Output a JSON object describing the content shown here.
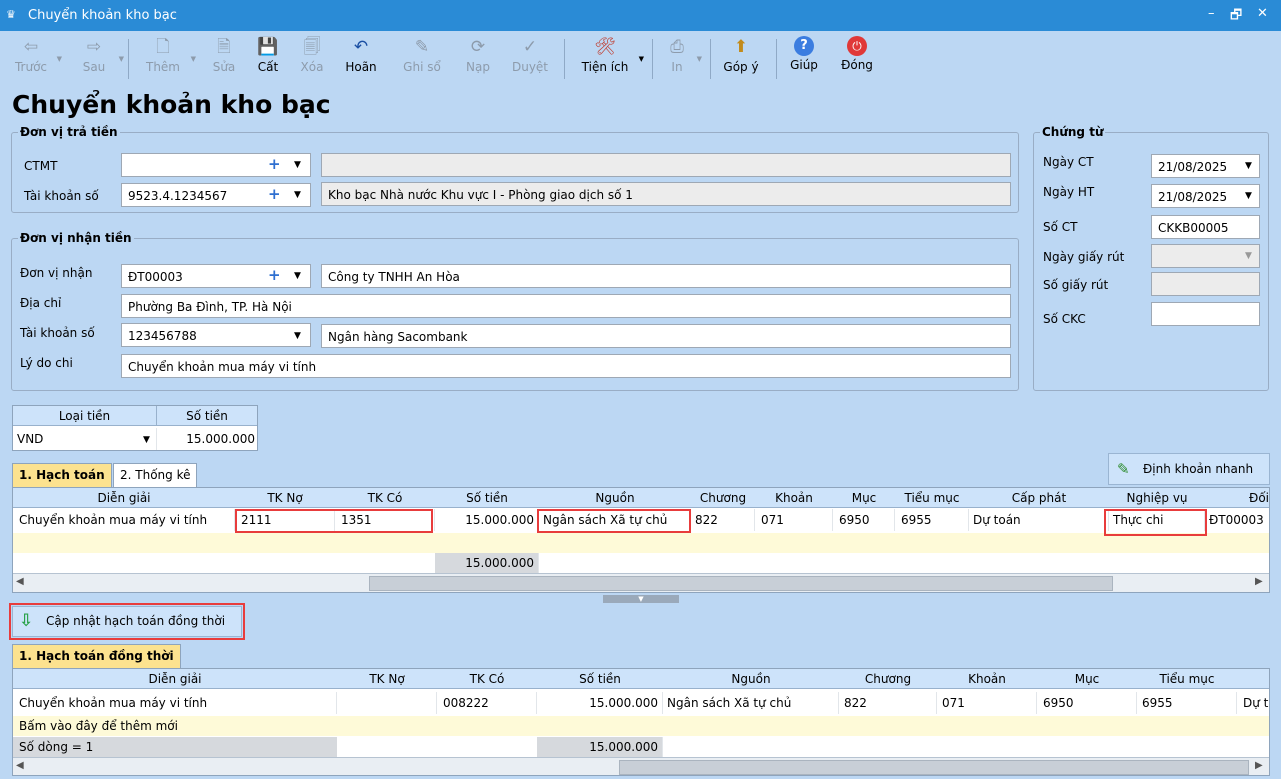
{
  "window": {
    "title": "Chuyển khoản kho bạc",
    "min": "–",
    "restore": "🗗",
    "close": "✕"
  },
  "toolbar": [
    {
      "id": "prev",
      "label": "Trước",
      "icon": "arrow-left-icon",
      "glyph": "⇦",
      "enabled": false
    },
    {
      "id": "next",
      "label": "Sau",
      "icon": "arrow-right-icon",
      "glyph": "⇨",
      "enabled": false
    },
    {
      "id": "add",
      "label": "Thêm",
      "icon": "add-document-icon",
      "glyph": "🗋",
      "enabled": false
    },
    {
      "id": "edit",
      "label": "Sửa",
      "icon": "edit-document-icon",
      "glyph": "🗎",
      "enabled": false
    },
    {
      "id": "save",
      "label": "Cất",
      "icon": "save-icon",
      "glyph": "💾",
      "enabled": true
    },
    {
      "id": "delete",
      "label": "Xóa",
      "icon": "delete-document-icon",
      "glyph": "🗐",
      "enabled": false
    },
    {
      "id": "undo",
      "label": "Hoãn",
      "icon": "undo-icon",
      "glyph": "↶",
      "enabled": true
    },
    {
      "id": "post",
      "label": "Ghi sổ",
      "icon": "pencil-icon",
      "glyph": "✎",
      "enabled": false
    },
    {
      "id": "reload",
      "label": "Nạp",
      "icon": "refresh-icon",
      "glyph": "⟳",
      "enabled": false
    },
    {
      "id": "approve",
      "label": "Duyệt",
      "icon": "check-icon",
      "glyph": "✓",
      "enabled": false
    },
    {
      "id": "utility",
      "label": "Tiện ích",
      "icon": "tools-icon",
      "glyph": "🛠",
      "enabled": true
    },
    {
      "id": "print",
      "label": "In",
      "icon": "printer-icon",
      "glyph": "⎙",
      "enabled": false
    },
    {
      "id": "feedback",
      "label": "Góp ý",
      "icon": "feedback-icon",
      "glyph": "⬆",
      "enabled": true
    },
    {
      "id": "help",
      "label": "Giúp",
      "icon": "help-icon",
      "glyph": "?",
      "enabled": true
    },
    {
      "id": "close",
      "label": "Đóng",
      "icon": "power-icon",
      "glyph": "⏻",
      "enabled": true
    }
  ],
  "page_title": "Chuyển khoản kho bạc",
  "payer": {
    "legend": "Đơn vị trả tiền",
    "ctmt_label": "CTMT",
    "ctmt_value": "",
    "ctmt_name": "",
    "account_label": "Tài khoản số",
    "account_value": "9523.4.1234567",
    "account_name": "Kho bạc Nhà nước Khu vực I - Phòng giao dịch số 1"
  },
  "payee": {
    "legend": "Đơn vị nhận tiền",
    "unit_label": "Đơn vị nhận",
    "unit_code": "ĐT00003",
    "unit_name": "Công ty TNHH An Hòa",
    "address_label": "Địa chỉ",
    "address": "Phường Ba Đình, TP. Hà Nội",
    "account_label": "Tài khoản số",
    "account": "123456788",
    "bank": "Ngân hàng Sacombank",
    "reason_label": "Lý do chi",
    "reason": "Chuyển khoản mua máy vi tính"
  },
  "voucher": {
    "legend": "Chứng từ",
    "date_ct_label": "Ngày CT",
    "date_ct": "21/08/2025",
    "date_ht_label": "Ngày HT",
    "date_ht": "21/08/2025",
    "so_ct_label": "Số CT",
    "so_ct": "CKKB00005",
    "withdraw_date_label": "Ngày giấy rút",
    "withdraw_no_label": "Số giấy rút",
    "ckc_label": "Số CKC"
  },
  "currency": {
    "type_header": "Loại tiền",
    "amount_header": "Số tiền",
    "type": "VND",
    "amount": "15.000.000"
  },
  "tabs": {
    "t1": "1. Hạch toán",
    "t2": "2. Thống kê"
  },
  "quick_entry": "Định khoản nhanh",
  "acct_grid": {
    "headers": [
      "Diễn giải",
      "TK Nợ",
      "TK Có",
      "Số tiền",
      "Nguồn",
      "Chương",
      "Khoản",
      "Mục",
      "Tiểu mục",
      "Cấp phát",
      "Nghiệp vụ",
      "Đối"
    ],
    "row": [
      "Chuyển khoản mua máy vi tính",
      "2111",
      "1351",
      "15.000.000",
      "Ngân sách Xã tự chủ",
      "822",
      "071",
      "6950",
      "6955",
      "Dự toán",
      "Thực chi",
      "ĐT00003"
    ],
    "total": "15.000.000"
  },
  "update_button": "Cập nhật hạch toán đồng thời",
  "tab_simul": "1. Hạch toán đồng thời",
  "simul_grid": {
    "headers": [
      "Diễn giải",
      "TK Nợ",
      "TK Có",
      "Số tiền",
      "Nguồn",
      "Chương",
      "Khoản",
      "Mục",
      "Tiểu mục",
      "Dự t"
    ],
    "row": [
      "Chuyển khoản mua máy vi tính",
      "",
      "008222",
      "15.000.000",
      "Ngân sách Xã tự chủ",
      "822",
      "071",
      "6950",
      "6955",
      "Dự t"
    ],
    "add_new": "Bấm vào đây để thêm mới",
    "row_count": "Số dòng = 1",
    "total": "15.000.000"
  }
}
